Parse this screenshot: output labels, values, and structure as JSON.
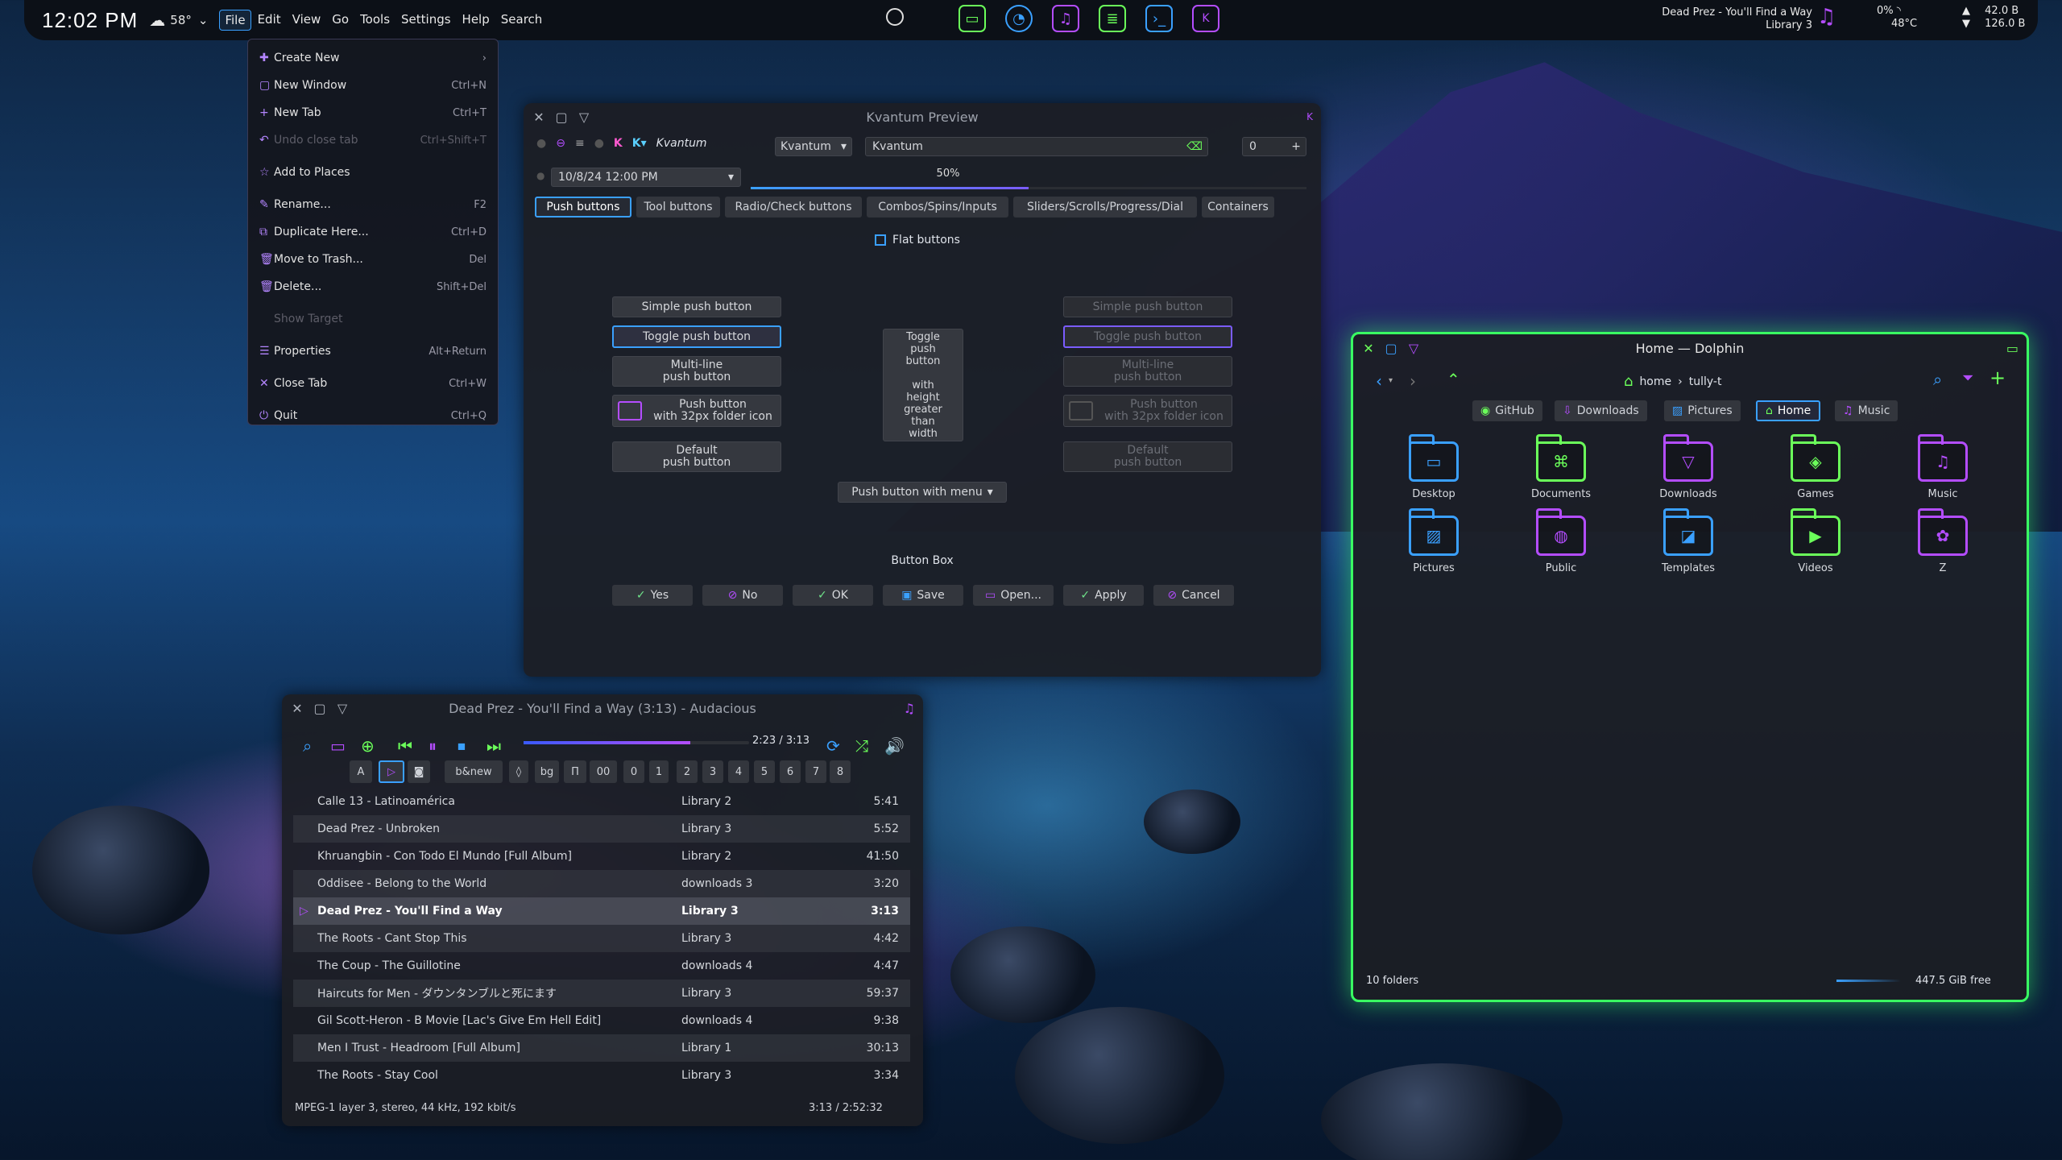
{
  "panel": {
    "clock": "12:02 PM",
    "weather_temp": "58°",
    "menus": [
      "File",
      "Edit",
      "View",
      "Go",
      "Tools",
      "Settings",
      "Help",
      "Search"
    ],
    "now_playing_title": "Dead Prez - You'll Find a Way",
    "now_playing_album": "Library 3",
    "battery": "0%",
    "cpu_temp": "48°C",
    "net_up": "42.0 B",
    "net_down": "126.0 B"
  },
  "file_menu": [
    {
      "icon": "✚",
      "label": "Create New",
      "shortcut": "›"
    },
    {
      "icon": "▢",
      "label": "New Window",
      "shortcut": "Ctrl+N"
    },
    {
      "icon": "+",
      "label": "New Tab",
      "shortcut": "Ctrl+T"
    },
    {
      "icon": "↶",
      "label": "Undo close tab",
      "shortcut": "Ctrl+Shift+T",
      "disabled": true
    },
    {
      "icon": "☆",
      "label": "Add to Places",
      "shortcut": ""
    },
    {
      "icon": "✎",
      "label": "Rename...",
      "shortcut": "F2"
    },
    {
      "icon": "⧉",
      "label": "Duplicate Here...",
      "shortcut": "Ctrl+D"
    },
    {
      "icon": "🗑",
      "label": "Move to Trash...",
      "shortcut": "Del"
    },
    {
      "icon": "🗑",
      "label": "Delete...",
      "shortcut": "Shift+Del"
    },
    {
      "icon": "",
      "label": "Show Target",
      "shortcut": "",
      "disabled": true
    },
    {
      "icon": "☰",
      "label": "Properties",
      "shortcut": "Alt+Return"
    },
    {
      "icon": "✕",
      "label": "Close Tab",
      "shortcut": "Ctrl+W"
    },
    {
      "icon": "⏻",
      "label": "Quit",
      "shortcut": "Ctrl+Q"
    }
  ],
  "kvantum": {
    "title": "Kvantum Preview",
    "theme_label": "Kvantum",
    "theme_combo": "Kvantum",
    "text_field": "Kvantum",
    "spin_value": "0",
    "datetime": "10/8/24 12:00 PM",
    "progress_label": "50%",
    "progress": 0.5,
    "tabs": [
      "Push buttons",
      "Tool buttons",
      "Radio/Check buttons",
      "Combos/Spins/Inputs",
      "Sliders/Scrolls/Progress/Dial",
      "Containers"
    ],
    "flat_label": "Flat buttons",
    "left_buttons": [
      "Simple push button",
      "Toggle push button",
      "Multi-line\npush button",
      "Push button\nwith 32px folder icon",
      "Default\npush button"
    ],
    "toggle_tall": "Toggle\npush\nbutton\n\nwith\nheight\ngreater\nthan\nwidth",
    "menu_button": "Push button with menu",
    "button_box_title": "Button Box",
    "button_box": [
      "Yes",
      "No",
      "OK",
      "Save",
      "Open...",
      "Apply",
      "Cancel"
    ]
  },
  "audacious": {
    "title": "Dead Prez - You'll Find a Way (3:13) - Audacious",
    "time": "2:23 / 3:13",
    "progress": 0.74,
    "eq_buttons": [
      "A",
      "",
      "",
      "b&new",
      "",
      "bg",
      "Π",
      "00",
      "0",
      "1",
      "2",
      "3",
      "4",
      "5",
      "6",
      "7",
      "8"
    ],
    "tracks": [
      {
        "title": "Calle 13 - Latinoamérica",
        "library": "Library 2",
        "dur": "5:41"
      },
      {
        "title": "Dead Prez - Unbroken",
        "library": "Library 3",
        "dur": "5:52"
      },
      {
        "title": "Khruangbin - Con Todo El Mundo [Full Album]",
        "library": "Library 2",
        "dur": "41:50"
      },
      {
        "title": "Oddisee - Belong to the World",
        "library": "downloads 3",
        "dur": "3:20"
      },
      {
        "title": "Dead Prez - You'll Find a Way",
        "library": "Library 3",
        "dur": "3:13"
      },
      {
        "title": "The Roots - Cant Stop This",
        "library": "Library 3",
        "dur": "4:42"
      },
      {
        "title": "The Coup - The Guillotine",
        "library": "downloads 4",
        "dur": "4:47"
      },
      {
        "title": "Haircuts for Men - ダウンタンブルと死にます",
        "library": "Library 3",
        "dur": "59:37"
      },
      {
        "title": "Gil Scott-Heron - B Movie [Lac's Give Em Hell Edit]",
        "library": "downloads 4",
        "dur": "9:38"
      },
      {
        "title": "Men I Trust - Headroom [Full Album]",
        "library": "Library 1",
        "dur": "30:13"
      },
      {
        "title": "The Roots - Stay Cool",
        "library": "Library 3",
        "dur": "3:34"
      }
    ],
    "status": "MPEG-1 layer 3, stereo, 44 kHz, 192 kbit/s",
    "total": "3:13 / 2:52:32"
  },
  "dolphin": {
    "title": "Home — Dolphin",
    "path": [
      "home",
      "tully-t"
    ],
    "places": [
      "GitHub",
      "Downloads",
      "Pictures",
      "Home",
      "Music"
    ],
    "folders": [
      {
        "name": "Desktop",
        "color": "#3aa0ff",
        "glyph": "▭"
      },
      {
        "name": "Documents",
        "color": "#6bff5a",
        "glyph": "⌘"
      },
      {
        "name": "Downloads",
        "color": "#b44dff",
        "glyph": "▽"
      },
      {
        "name": "Games",
        "color": "#6bff5a",
        "glyph": "◈"
      },
      {
        "name": "Music",
        "color": "#b44dff",
        "glyph": "♫"
      },
      {
        "name": "Pictures",
        "color": "#3aa0ff",
        "glyph": "▨"
      },
      {
        "name": "Public",
        "color": "#b44dff",
        "glyph": "◍"
      },
      {
        "name": "Templates",
        "color": "#3aa0ff",
        "glyph": "◪"
      },
      {
        "name": "Videos",
        "color": "#6bff5a",
        "glyph": "▶"
      },
      {
        "name": "Z",
        "color": "#b44dff",
        "glyph": "✿"
      }
    ],
    "status": "10 folders",
    "free": "447.5 GiB free"
  }
}
